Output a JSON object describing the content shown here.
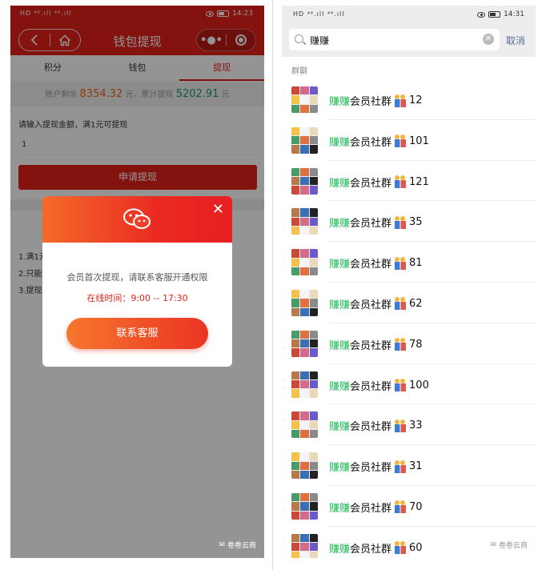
{
  "left": {
    "status": {
      "signal": "HD ⁴⁶.ıll ⁴⁶.ıll",
      "time": "14:23"
    },
    "header": {
      "title": "钱包提现"
    },
    "tabs": [
      {
        "label": "积分"
      },
      {
        "label": "钱包"
      },
      {
        "label": "提现"
      }
    ],
    "balance": {
      "prefix": "账户剩余",
      "amount": "8354.32",
      "mid": "元，累计提现",
      "total": "5202.91",
      "suffix": "元"
    },
    "form": {
      "label": "请输入提现金额，满1元可提现",
      "value": "1",
      "submit": "申请提现"
    },
    "rules": [
      "1.满1元",
      "2.只能",
      "3.提现"
    ],
    "dialog": {
      "message": "会员首次提现，请联系客服开通权限",
      "hours": "在线时间：9:00 -- 17:30",
      "button": "联系客服"
    },
    "watermark": "卷卷云商",
    "colors": {
      "brand": "#e3211b",
      "amount": "#f06a18",
      "total": "#18a06a"
    }
  },
  "right": {
    "status": {
      "signal": "HD ⁴⁶.ıll ⁴⁶.ıll",
      "time": "14:31"
    },
    "search": {
      "query": "赚赚",
      "cancel": "取消"
    },
    "section": "群聊",
    "group_highlight": "赚赚",
    "group_name": "会员社群",
    "groups": [
      {
        "count": "12"
      },
      {
        "count": "101"
      },
      {
        "count": "121"
      },
      {
        "count": "35"
      },
      {
        "count": "81"
      },
      {
        "count": "62"
      },
      {
        "count": "78"
      },
      {
        "count": "100"
      },
      {
        "count": "33"
      },
      {
        "count": "31"
      },
      {
        "count": "70"
      },
      {
        "count": "60"
      }
    ],
    "watermark": "卷卷云商",
    "colors": {
      "highlight": "#19b955",
      "link": "#576b95"
    }
  }
}
